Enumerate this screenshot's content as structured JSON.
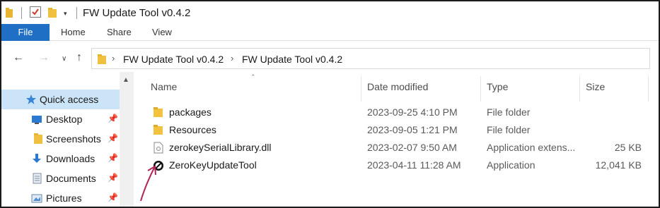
{
  "window": {
    "title": "FW Update Tool v0.4.2"
  },
  "ribbon": {
    "tabs": [
      "File",
      "Home",
      "Share",
      "View"
    ]
  },
  "address": {
    "crumbs": [
      "FW Update Tool v0.4.2",
      "FW Update Tool v0.4.2"
    ]
  },
  "nav": {
    "items": [
      {
        "label": "Quick access",
        "icon": "star-icon",
        "pinned": false,
        "selected": true
      },
      {
        "label": "Desktop",
        "icon": "desktop-icon",
        "pinned": true
      },
      {
        "label": "Screenshots",
        "icon": "folder-icon",
        "pinned": true
      },
      {
        "label": "Downloads",
        "icon": "download-icon",
        "pinned": true
      },
      {
        "label": "Documents",
        "icon": "documents-icon",
        "pinned": true
      },
      {
        "label": "Pictures",
        "icon": "pictures-icon",
        "pinned": true
      }
    ]
  },
  "columns": {
    "name": "Name",
    "date": "Date modified",
    "type": "Type",
    "size": "Size"
  },
  "files": [
    {
      "name": "packages",
      "date": "2023-09-25 4:10 PM",
      "type": "File folder",
      "size": "",
      "icon": "folder-icon"
    },
    {
      "name": "Resources",
      "date": "2023-09-05 1:21 PM",
      "type": "File folder",
      "size": "",
      "icon": "folder-icon"
    },
    {
      "name": "zerokeySerialLibrary.dll",
      "date": "2023-02-07 9:50 AM",
      "type": "Application extens...",
      "size": "25 KB",
      "icon": "dll-icon"
    },
    {
      "name": "ZeroKeyUpdateTool",
      "date": "2023-04-11 11:28 AM",
      "type": "Application",
      "size": "12,041 KB",
      "icon": "app-icon"
    }
  ],
  "colors": {
    "accent": "#1f6fc5",
    "selection": "#cce4f7",
    "folder": "#f3c33f",
    "annotation_arrow": "#b0245a"
  }
}
